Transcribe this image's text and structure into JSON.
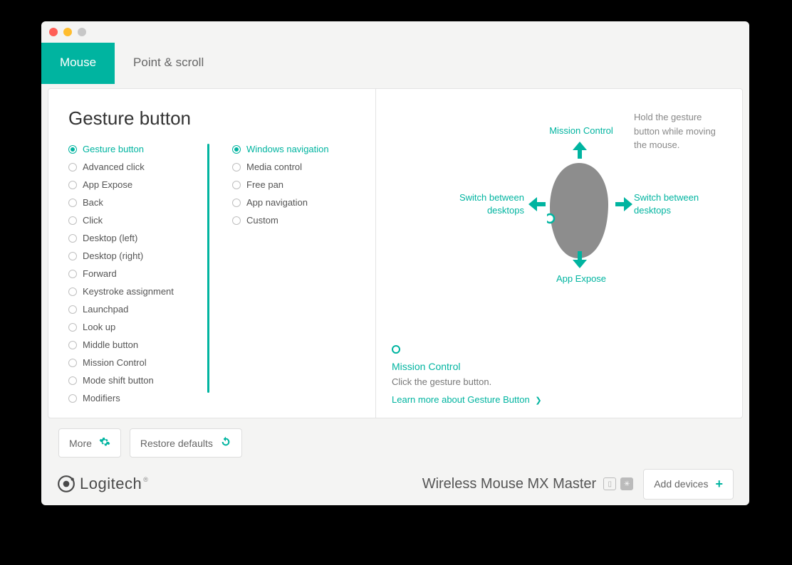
{
  "tabs": {
    "mouse": "Mouse",
    "point_scroll": "Point & scroll"
  },
  "page_title": "Gesture button",
  "list1": [
    {
      "label": "Gesture button",
      "selected": true
    },
    {
      "label": "Advanced click"
    },
    {
      "label": "App Expose"
    },
    {
      "label": "Back"
    },
    {
      "label": "Click"
    },
    {
      "label": "Desktop (left)"
    },
    {
      "label": "Desktop (right)"
    },
    {
      "label": "Forward"
    },
    {
      "label": "Keystroke assignment"
    },
    {
      "label": "Launchpad"
    },
    {
      "label": "Look up"
    },
    {
      "label": "Middle button"
    },
    {
      "label": "Mission Control"
    },
    {
      "label": "Mode shift button"
    },
    {
      "label": "Modifiers"
    }
  ],
  "list2": [
    {
      "label": "Windows navigation",
      "selected": true
    },
    {
      "label": "Media control"
    },
    {
      "label": "Free pan"
    },
    {
      "label": "App navigation"
    },
    {
      "label": "Custom"
    }
  ],
  "hint": "Hold the gesture button while moving the mouse.",
  "directions": {
    "up": "Mission Control",
    "down": "App Expose",
    "left": "Switch between desktops",
    "right": "Switch between desktops"
  },
  "info": {
    "title": "Mission Control",
    "sub": "Click the gesture button.",
    "link": "Learn more about Gesture Button"
  },
  "buttons": {
    "more": "More",
    "restore": "Restore defaults",
    "add_devices": "Add devices"
  },
  "footer": {
    "brand": "Logitech",
    "device": "Wireless Mouse MX Master"
  }
}
